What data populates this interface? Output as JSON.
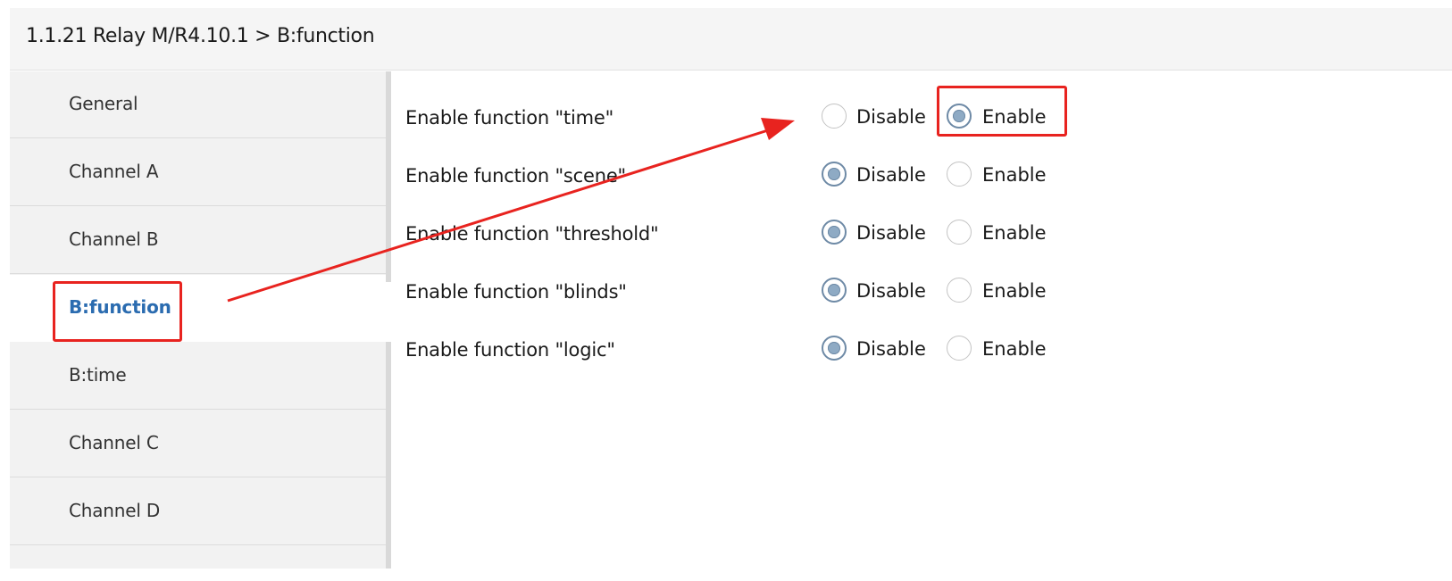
{
  "header": {
    "title": "1.1.21 Relay M/R4.10.1 > B:function"
  },
  "sidebar": {
    "items": [
      {
        "label": "General",
        "active": false
      },
      {
        "label": "Channel A",
        "active": false
      },
      {
        "label": "Channel B",
        "active": false
      },
      {
        "label": "B:function",
        "active": true
      },
      {
        "label": "B:time",
        "active": false
      },
      {
        "label": "Channel C",
        "active": false
      },
      {
        "label": "Channel D",
        "active": false
      }
    ]
  },
  "options": {
    "disable_label": "Disable",
    "enable_label": "Enable"
  },
  "settings": [
    {
      "label": "Enable function \"time\"",
      "selected": "Enable"
    },
    {
      "label": "Enable function \"scene\"",
      "selected": "Disable"
    },
    {
      "label": "Enable function \"threshold\"",
      "selected": "Disable"
    },
    {
      "label": "Enable function \"blinds\"",
      "selected": "Disable"
    },
    {
      "label": "Enable function \"logic\"",
      "selected": "Disable"
    }
  ],
  "annotation": {
    "color": "#e8231f"
  }
}
